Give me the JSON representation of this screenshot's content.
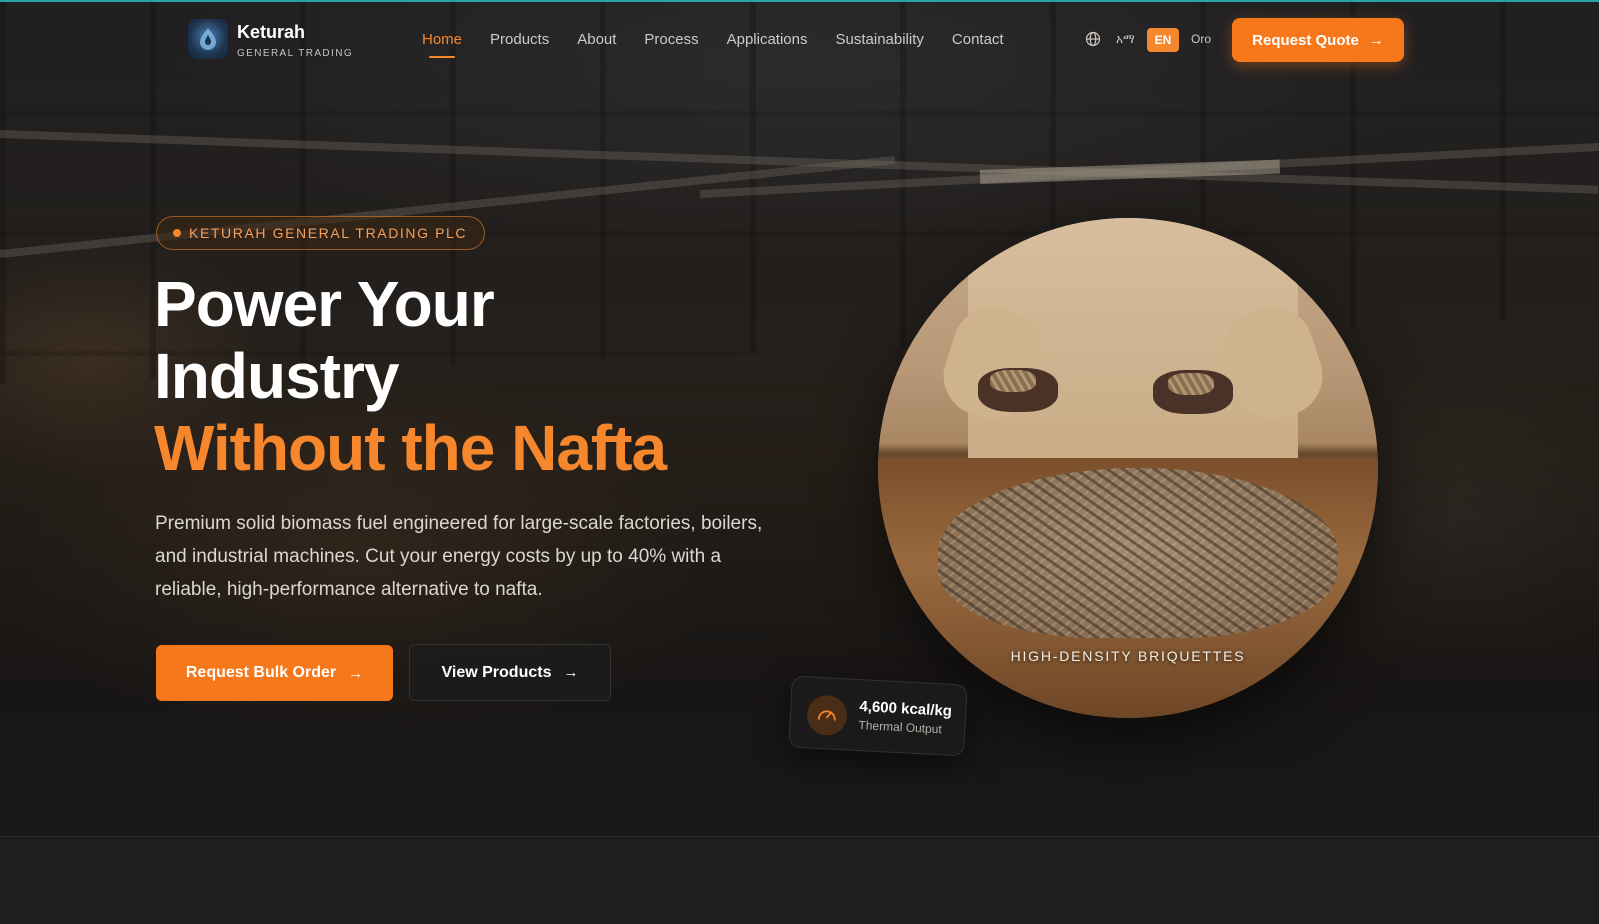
{
  "brand": {
    "name": "Keturah",
    "subtitle": "GENERAL TRADING"
  },
  "nav": {
    "items": [
      {
        "label": "Home",
        "active": true
      },
      {
        "label": "Products",
        "active": false
      },
      {
        "label": "About",
        "active": false
      },
      {
        "label": "Process",
        "active": false
      },
      {
        "label": "Applications",
        "active": false
      },
      {
        "label": "Sustainability",
        "active": false
      },
      {
        "label": "Contact",
        "active": false
      }
    ],
    "languages": {
      "amharic": "አማ",
      "english": "EN",
      "oromo": "Oro"
    },
    "cta_label": "Request Quote"
  },
  "hero": {
    "badge": "KETURAH GENERAL TRADING PLC",
    "headline_line1": "Power Your",
    "headline_line2": "Industry",
    "headline_line3": "Without the Nafta",
    "description": "Premium solid biomass fuel engineered for large-scale factories, boilers, and industrial machines. Cut your energy costs by up to 40% with a reliable, high-performance alternative to nafta.",
    "primary_button": "Request Bulk Order",
    "secondary_button": "View Products",
    "image_caption": "HIGH-DENSITY BRIQUETTES",
    "stat": {
      "value": "4,600 kcal/kg",
      "label": "Thermal Output"
    }
  },
  "icons": {
    "globe": "globe-icon",
    "arrow": "arrow-right-icon",
    "gauge": "gauge-icon",
    "logo": "logo-icon"
  },
  "colors": {
    "accent": "#f7872c",
    "button": "#f7781b",
    "top_line": "#2aa3a8",
    "background": "#1c1c1c"
  }
}
